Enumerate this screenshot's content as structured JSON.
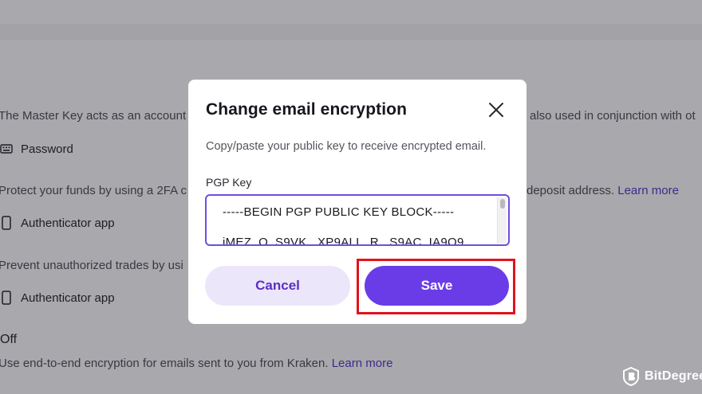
{
  "background": {
    "master_key_text": "The Master Key acts as an account",
    "master_key_text_right": "also used in conjunction with ot",
    "password_label": "Password",
    "protect_text": "Protect your funds by using a 2FA c",
    "protect_text_right": "deposit address.",
    "learn_more_1": "Learn more",
    "auth_app_1": "Authenticator app",
    "prevent_text": "Prevent unauthorized trades by usi",
    "auth_app_2": "Authenticator app",
    "off_label": "Off",
    "encryption_text": "Use end-to-end encryption for emails sent to you from Kraken.",
    "learn_more_2": "Learn more"
  },
  "modal": {
    "title": "Change email encryption",
    "description": "Copy/paste your public key to receive encrypted email.",
    "field_label": "PGP Key",
    "key_line_1": "-----BEGIN PGP PUBLIC KEY BLOCK-----",
    "key_line_2": "iMEZ..O..S9VK...XP9ALL..R...S9AC..IA9Q9",
    "cancel_label": "Cancel",
    "save_label": "Save"
  },
  "watermark": {
    "text": "BitDegree"
  },
  "colors": {
    "accent": "#6a3ce8",
    "accent_light": "#ece6fb",
    "highlight": "#e3121b",
    "overlay": "#a9a8ac"
  }
}
